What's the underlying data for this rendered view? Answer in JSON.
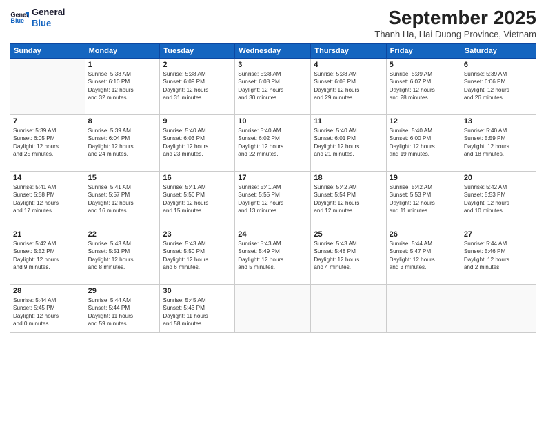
{
  "logo": {
    "line1": "General",
    "line2": "Blue"
  },
  "title": "September 2025",
  "subtitle": "Thanh Ha, Hai Duong Province, Vietnam",
  "weekdays": [
    "Sunday",
    "Monday",
    "Tuesday",
    "Wednesday",
    "Thursday",
    "Friday",
    "Saturday"
  ],
  "weeks": [
    [
      {
        "day": "",
        "info": ""
      },
      {
        "day": "1",
        "info": "Sunrise: 5:38 AM\nSunset: 6:10 PM\nDaylight: 12 hours\nand 32 minutes."
      },
      {
        "day": "2",
        "info": "Sunrise: 5:38 AM\nSunset: 6:09 PM\nDaylight: 12 hours\nand 31 minutes."
      },
      {
        "day": "3",
        "info": "Sunrise: 5:38 AM\nSunset: 6:08 PM\nDaylight: 12 hours\nand 30 minutes."
      },
      {
        "day": "4",
        "info": "Sunrise: 5:38 AM\nSunset: 6:08 PM\nDaylight: 12 hours\nand 29 minutes."
      },
      {
        "day": "5",
        "info": "Sunrise: 5:39 AM\nSunset: 6:07 PM\nDaylight: 12 hours\nand 28 minutes."
      },
      {
        "day": "6",
        "info": "Sunrise: 5:39 AM\nSunset: 6:06 PM\nDaylight: 12 hours\nand 26 minutes."
      }
    ],
    [
      {
        "day": "7",
        "info": "Sunrise: 5:39 AM\nSunset: 6:05 PM\nDaylight: 12 hours\nand 25 minutes."
      },
      {
        "day": "8",
        "info": "Sunrise: 5:39 AM\nSunset: 6:04 PM\nDaylight: 12 hours\nand 24 minutes."
      },
      {
        "day": "9",
        "info": "Sunrise: 5:40 AM\nSunset: 6:03 PM\nDaylight: 12 hours\nand 23 minutes."
      },
      {
        "day": "10",
        "info": "Sunrise: 5:40 AM\nSunset: 6:02 PM\nDaylight: 12 hours\nand 22 minutes."
      },
      {
        "day": "11",
        "info": "Sunrise: 5:40 AM\nSunset: 6:01 PM\nDaylight: 12 hours\nand 21 minutes."
      },
      {
        "day": "12",
        "info": "Sunrise: 5:40 AM\nSunset: 6:00 PM\nDaylight: 12 hours\nand 19 minutes."
      },
      {
        "day": "13",
        "info": "Sunrise: 5:40 AM\nSunset: 5:59 PM\nDaylight: 12 hours\nand 18 minutes."
      }
    ],
    [
      {
        "day": "14",
        "info": "Sunrise: 5:41 AM\nSunset: 5:58 PM\nDaylight: 12 hours\nand 17 minutes."
      },
      {
        "day": "15",
        "info": "Sunrise: 5:41 AM\nSunset: 5:57 PM\nDaylight: 12 hours\nand 16 minutes."
      },
      {
        "day": "16",
        "info": "Sunrise: 5:41 AM\nSunset: 5:56 PM\nDaylight: 12 hours\nand 15 minutes."
      },
      {
        "day": "17",
        "info": "Sunrise: 5:41 AM\nSunset: 5:55 PM\nDaylight: 12 hours\nand 13 minutes."
      },
      {
        "day": "18",
        "info": "Sunrise: 5:42 AM\nSunset: 5:54 PM\nDaylight: 12 hours\nand 12 minutes."
      },
      {
        "day": "19",
        "info": "Sunrise: 5:42 AM\nSunset: 5:53 PM\nDaylight: 12 hours\nand 11 minutes."
      },
      {
        "day": "20",
        "info": "Sunrise: 5:42 AM\nSunset: 5:53 PM\nDaylight: 12 hours\nand 10 minutes."
      }
    ],
    [
      {
        "day": "21",
        "info": "Sunrise: 5:42 AM\nSunset: 5:52 PM\nDaylight: 12 hours\nand 9 minutes."
      },
      {
        "day": "22",
        "info": "Sunrise: 5:43 AM\nSunset: 5:51 PM\nDaylight: 12 hours\nand 8 minutes."
      },
      {
        "day": "23",
        "info": "Sunrise: 5:43 AM\nSunset: 5:50 PM\nDaylight: 12 hours\nand 6 minutes."
      },
      {
        "day": "24",
        "info": "Sunrise: 5:43 AM\nSunset: 5:49 PM\nDaylight: 12 hours\nand 5 minutes."
      },
      {
        "day": "25",
        "info": "Sunrise: 5:43 AM\nSunset: 5:48 PM\nDaylight: 12 hours\nand 4 minutes."
      },
      {
        "day": "26",
        "info": "Sunrise: 5:44 AM\nSunset: 5:47 PM\nDaylight: 12 hours\nand 3 minutes."
      },
      {
        "day": "27",
        "info": "Sunrise: 5:44 AM\nSunset: 5:46 PM\nDaylight: 12 hours\nand 2 minutes."
      }
    ],
    [
      {
        "day": "28",
        "info": "Sunrise: 5:44 AM\nSunset: 5:45 PM\nDaylight: 12 hours\nand 0 minutes."
      },
      {
        "day": "29",
        "info": "Sunrise: 5:44 AM\nSunset: 5:44 PM\nDaylight: 11 hours\nand 59 minutes."
      },
      {
        "day": "30",
        "info": "Sunrise: 5:45 AM\nSunset: 5:43 PM\nDaylight: 11 hours\nand 58 minutes."
      },
      {
        "day": "",
        "info": ""
      },
      {
        "day": "",
        "info": ""
      },
      {
        "day": "",
        "info": ""
      },
      {
        "day": "",
        "info": ""
      }
    ]
  ]
}
